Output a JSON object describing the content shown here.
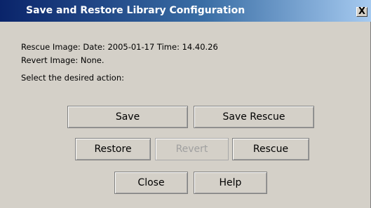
{
  "window": {
    "title": "Save and Restore Library Configuration",
    "close_glyph": "X"
  },
  "info": {
    "rescue_line": "Rescue Image: Date: 2005-01-17 Time: 14.40.26",
    "revert_line": "Revert Image: None.",
    "prompt": "Select the desired action:"
  },
  "buttons": {
    "save": "Save",
    "save_rescue": "Save Rescue",
    "restore": "Restore",
    "revert": "Revert",
    "rescue": "Rescue",
    "close": "Close",
    "help": "Help"
  },
  "colors": {
    "title_gradient_start": "#0a246a",
    "title_gradient_end": "#a6caf0",
    "dialog_background": "#d4d0c8",
    "disabled_text": "#a0a0a0"
  }
}
